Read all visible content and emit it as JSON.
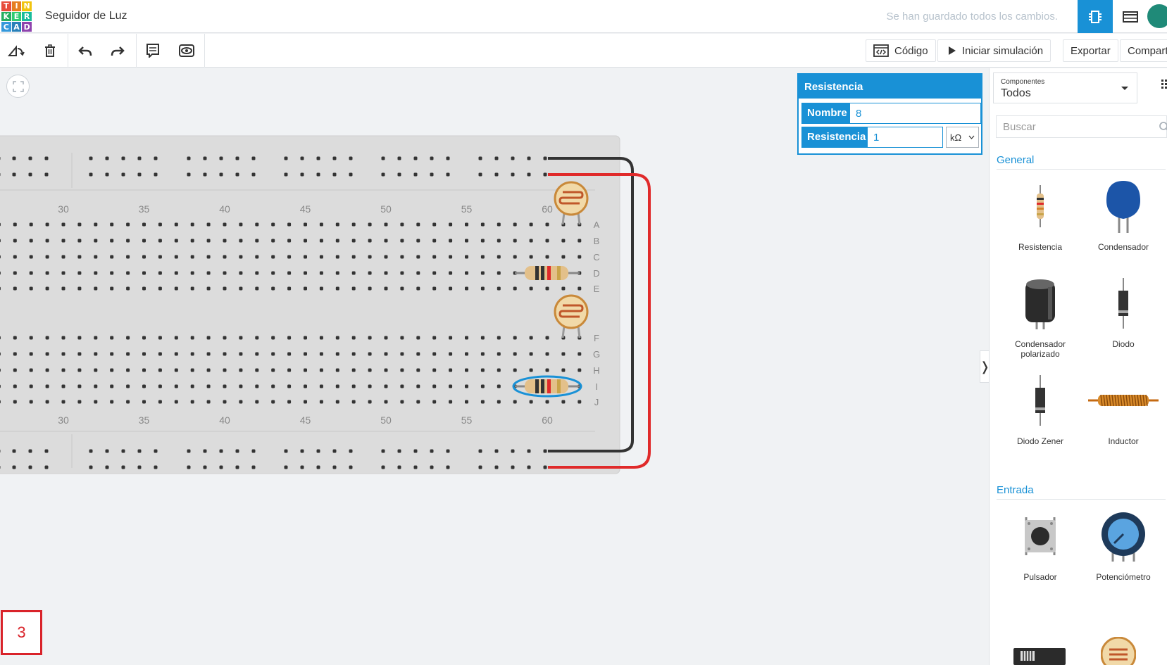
{
  "app": {
    "logo_letters": [
      "T",
      "I",
      "N",
      "K",
      "E",
      "R",
      "C",
      "A",
      "D"
    ],
    "logo_colors": [
      "#e74c3c",
      "#e67e22",
      "#f1c40f",
      "#27ae60",
      "#2ecc71",
      "#1abc9c",
      "#3498db",
      "#2980b9",
      "#8e44ad"
    ],
    "project_title": "Seguidor de Luz",
    "save_status": "Se han guardado todos los cambios."
  },
  "toolbar": {
    "code_label": "Código",
    "simulate_label": "Iniciar simulación",
    "export_label": "Exportar",
    "share_label": "Compartir"
  },
  "inspector": {
    "title": "Resistencia",
    "name_label": "Nombre",
    "name_value": "8",
    "resistance_label": "Resistencia",
    "resistance_value": "1",
    "unit": "kΩ"
  },
  "breadboard": {
    "column_labels": [
      "30",
      "35",
      "40",
      "45",
      "50",
      "55",
      "60"
    ],
    "row_labels_top": [
      "A",
      "B",
      "C",
      "D",
      "E"
    ],
    "row_labels_bottom": [
      "F",
      "G",
      "H",
      "I",
      "J"
    ]
  },
  "sidebar": {
    "components_small": "Componentes",
    "components_value": "Todos",
    "search_placeholder": "Buscar",
    "sections": [
      {
        "title": "General",
        "items": [
          {
            "label": "Resistencia"
          },
          {
            "label": "Condensador"
          },
          {
            "label": "Condensador polarizado"
          },
          {
            "label": "Diodo"
          },
          {
            "label": "Diodo Zener"
          },
          {
            "label": "Inductor"
          }
        ]
      },
      {
        "title": "Entrada",
        "items": [
          {
            "label": "Pulsador"
          },
          {
            "label": "Potenciómetro"
          }
        ]
      }
    ]
  },
  "slide_number": "3",
  "colors": {
    "accent": "#1991d6",
    "wire_red": "#e02a2a",
    "wire_black": "#333333",
    "slide_border": "#d9232a"
  }
}
